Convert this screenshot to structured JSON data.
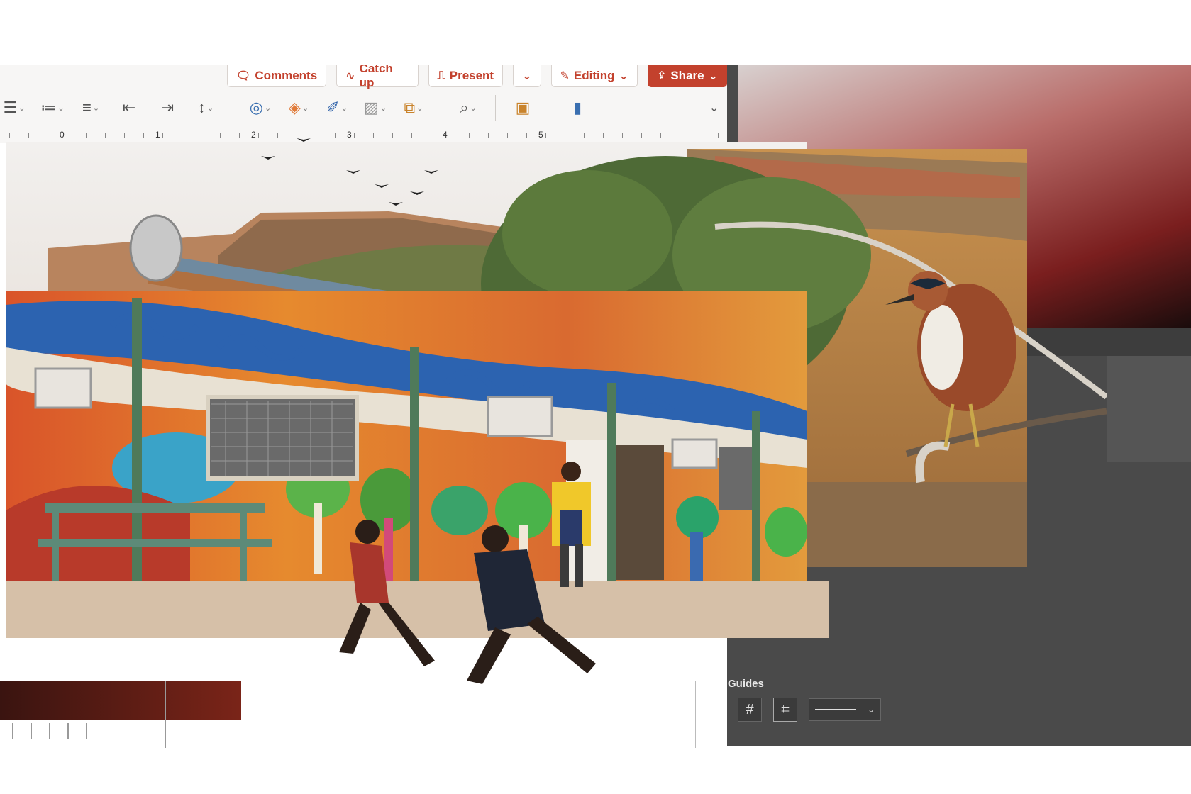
{
  "ppt": {
    "tabs": [
      {
        "icon": "comment-icon",
        "label": "Comments"
      },
      {
        "icon": "activity-icon",
        "label": "Catch up"
      },
      {
        "icon": "present-icon",
        "label": "Present"
      },
      {
        "icon": "chevron-down-icon",
        "label": ""
      },
      {
        "icon": "pencil-icon",
        "label": "Editing"
      },
      {
        "icon": "share-icon",
        "label": "Share"
      }
    ],
    "ruler_marks": [
      "0",
      "1",
      "2",
      "3",
      "4",
      "5"
    ]
  },
  "ps": {
    "guides_label": "Guides"
  },
  "colors": {
    "accent": "#c3412d",
    "panel_dark": "#4a4a4a"
  }
}
